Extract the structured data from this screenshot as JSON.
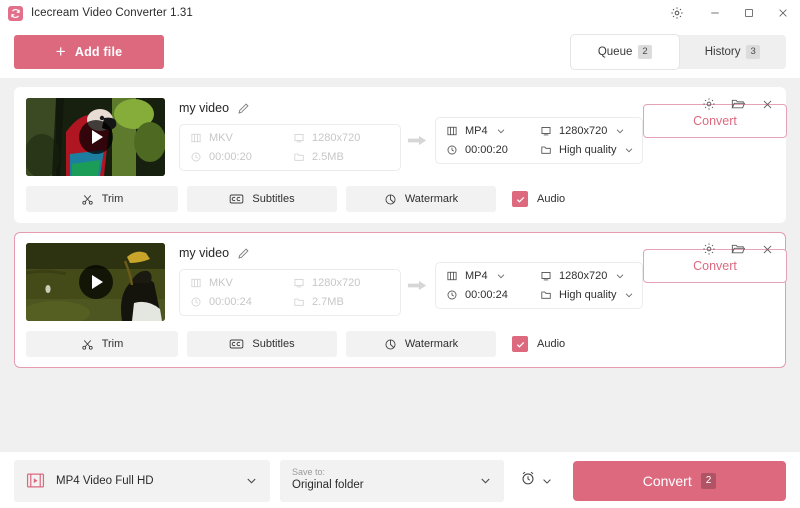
{
  "window": {
    "title": "Icecream Video Converter 1.31",
    "app_icon": "refresh-convert-icon",
    "settings_icon": "gear-icon",
    "minimize_icon": "minimize-icon",
    "maximize_icon": "maximize-icon",
    "close_icon": "close-icon",
    "accent_color": "#dd697f",
    "content_bg": "#f0f0f0"
  },
  "toolbar": {
    "add_file_label": "Add file",
    "add_file_icon": "plus-icon",
    "tabs": [
      {
        "label": "Queue",
        "badge": "2",
        "active": true
      },
      {
        "label": "History",
        "badge": "3",
        "active": false
      }
    ]
  },
  "cards": [
    {
      "selected": false,
      "thumbnail": "red-macaw-parrot-in-green-foliage",
      "play_icon": "play-icon",
      "file_title": "my video",
      "edit_icon": "pencil-icon",
      "source": {
        "format_icon": "film-icon",
        "format": "MKV",
        "resolution_icon": "monitor-icon",
        "resolution": "1280x720",
        "duration_icon": "clock-icon",
        "duration": "00:00:20",
        "size_icon": "folder-icon",
        "size": "2.5MB"
      },
      "arrow_icon": "arrow-right-icon",
      "output": {
        "format_icon": "film-icon",
        "format": "MP4",
        "resolution_icon": "monitor-icon",
        "resolution": "1280x720",
        "duration_icon": "clock-icon",
        "duration": "00:00:20",
        "quality_icon": "folder-icon",
        "quality": "High quality",
        "chevron_icon": "chevron-down-icon"
      },
      "convert_label": "Convert",
      "row_icons": {
        "settings_icon": "gear-icon",
        "folder_icon": "folder-open-icon",
        "remove_icon": "close-icon"
      },
      "actions": {
        "trim_label": "Trim",
        "trim_icon": "scissors-icon",
        "subtitles_label": "Subtitles",
        "subtitles_icon": "closed-caption-icon",
        "watermark_label": "Watermark",
        "watermark_icon": "watermark-icon",
        "audio_label": "Audio",
        "audio_checked": true,
        "audio_check_icon": "check-icon"
      }
    },
    {
      "selected": true,
      "thumbnail": "dark-bird-on-grass-field",
      "play_icon": "play-icon",
      "file_title": "my video",
      "edit_icon": "pencil-icon",
      "source": {
        "format_icon": "film-icon",
        "format": "MKV",
        "resolution_icon": "monitor-icon",
        "resolution": "1280x720",
        "duration_icon": "clock-icon",
        "duration": "00:00:24",
        "size_icon": "folder-icon",
        "size": "2.7MB"
      },
      "arrow_icon": "arrow-right-icon",
      "output": {
        "format_icon": "film-icon",
        "format": "MP4",
        "resolution_icon": "monitor-icon",
        "resolution": "1280x720",
        "duration_icon": "clock-icon",
        "duration": "00:00:24",
        "quality_icon": "folder-icon",
        "quality": "High quality",
        "chevron_icon": "chevron-down-icon"
      },
      "convert_label": "Convert",
      "row_icons": {
        "settings_icon": "gear-icon",
        "folder_icon": "folder-open-icon",
        "remove_icon": "close-icon"
      },
      "actions": {
        "trim_label": "Trim",
        "trim_icon": "scissors-icon",
        "subtitles_label": "Subtitles",
        "subtitles_icon": "closed-caption-icon",
        "watermark_label": "Watermark",
        "watermark_icon": "watermark-icon",
        "audio_label": "Audio",
        "audio_checked": true,
        "audio_check_icon": "check-icon"
      }
    }
  ],
  "bottom": {
    "format_icon": "video-file-icon",
    "format_value": "MP4 Video Full HD",
    "format_chevron": "chevron-down-icon",
    "save_hint": "Save to:",
    "save_value": "Original folder",
    "save_chevron": "chevron-down-icon",
    "timer_icon": "alarm-clock-icon",
    "timer_chevron": "chevron-down-icon",
    "convert_label": "Convert",
    "convert_badge": "2"
  }
}
